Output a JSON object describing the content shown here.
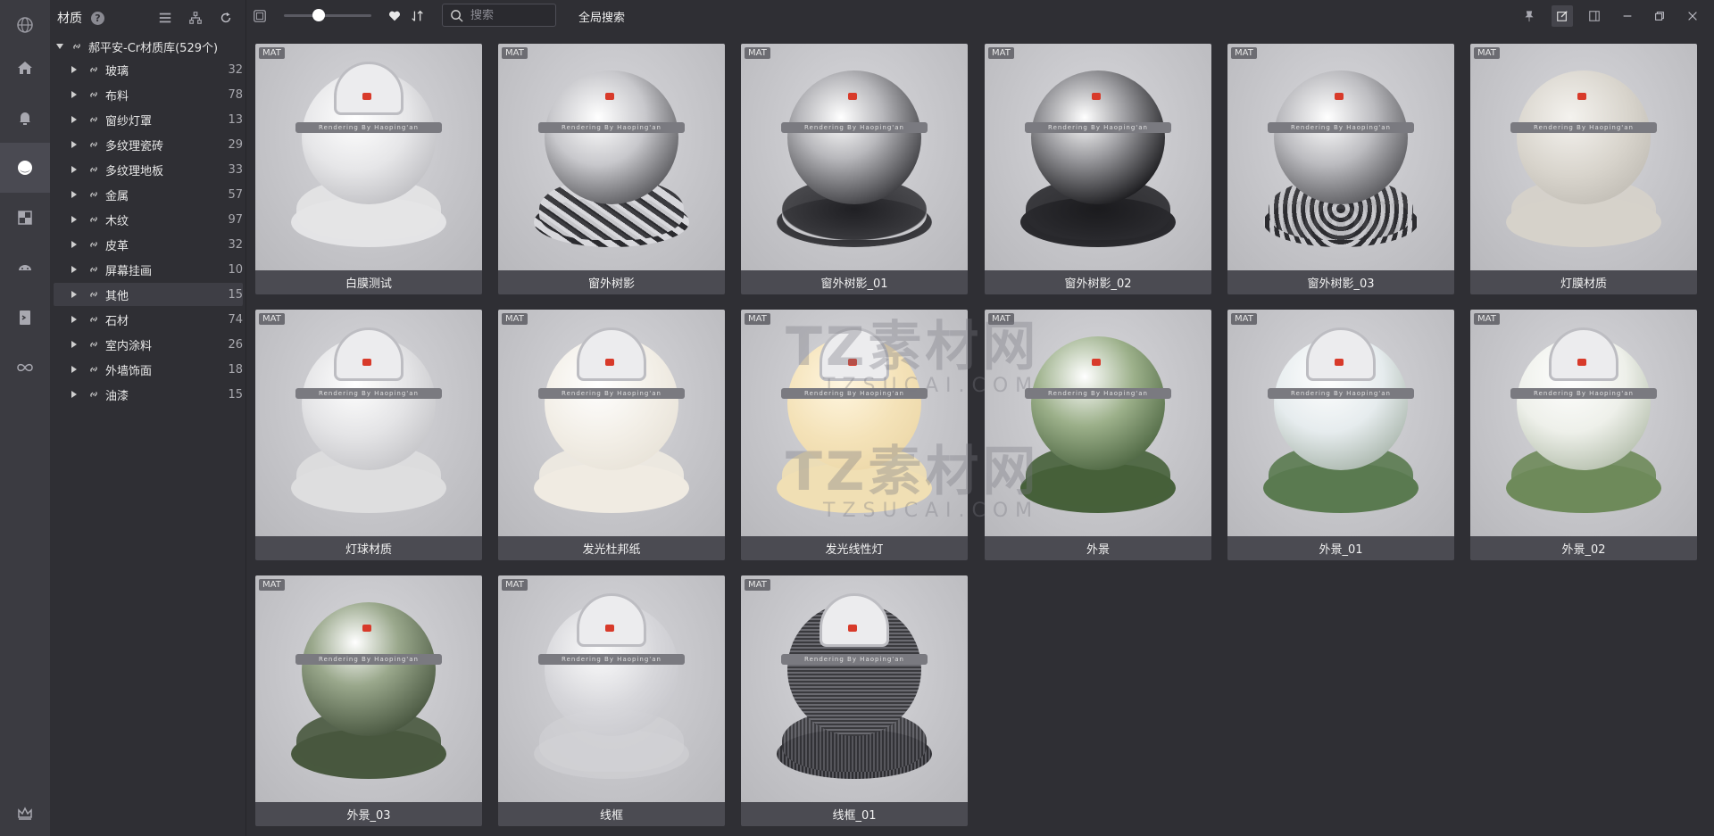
{
  "rail": {
    "icons": [
      "globe-icon",
      "home-icon",
      "bell-icon",
      "material-sphere-icon",
      "texture-icon",
      "gamepad-icon",
      "script-icon",
      "infinity-icon",
      "crown-icon"
    ]
  },
  "panel": {
    "title": "材质",
    "help": "?",
    "root_label": "郝平安-Cr材质库(529个)",
    "categories": [
      {
        "label": "玻璃",
        "count": "32"
      },
      {
        "label": "布料",
        "count": "78"
      },
      {
        "label": "窗纱灯罩",
        "count": "13"
      },
      {
        "label": "多纹理瓷砖",
        "count": "29"
      },
      {
        "label": "多纹理地板",
        "count": "33"
      },
      {
        "label": "金属",
        "count": "57"
      },
      {
        "label": "木纹",
        "count": "97"
      },
      {
        "label": "皮革",
        "count": "32"
      },
      {
        "label": "屏幕挂画",
        "count": "10"
      },
      {
        "label": "其他",
        "count": "15"
      },
      {
        "label": "石材",
        "count": "74"
      },
      {
        "label": "室内涂料",
        "count": "26"
      },
      {
        "label": "外墙饰面",
        "count": "18"
      },
      {
        "label": "油漆",
        "count": "15"
      }
    ]
  },
  "toolbar": {
    "search_placeholder": "搜索",
    "global_search": "全局搜索",
    "thumb_size": 0.4
  },
  "items": [
    {
      "label": "白膜测试",
      "badge": "MAT"
    },
    {
      "label": "窗外树影",
      "badge": "MAT"
    },
    {
      "label": "窗外树影_01",
      "badge": "MAT"
    },
    {
      "label": "窗外树影_02",
      "badge": "MAT"
    },
    {
      "label": "窗外树影_03",
      "badge": "MAT"
    },
    {
      "label": "灯膜材质",
      "badge": "MAT"
    },
    {
      "label": "灯球材质",
      "badge": "MAT"
    },
    {
      "label": "发光杜邦纸",
      "badge": "MAT"
    },
    {
      "label": "发光线性灯",
      "badge": "MAT"
    },
    {
      "label": "外景",
      "badge": "MAT"
    },
    {
      "label": "外景_01",
      "badge": "MAT"
    },
    {
      "label": "外景_02",
      "badge": "MAT"
    },
    {
      "label": "外景_03",
      "badge": "MAT"
    },
    {
      "label": "线框",
      "badge": "MAT"
    },
    {
      "label": "线框_01",
      "badge": "MAT"
    }
  ],
  "render_text": "Rendering By Haoping'an",
  "watermark": {
    "main": "TZ素材网",
    "sub": "TZSUCAI.COM"
  }
}
